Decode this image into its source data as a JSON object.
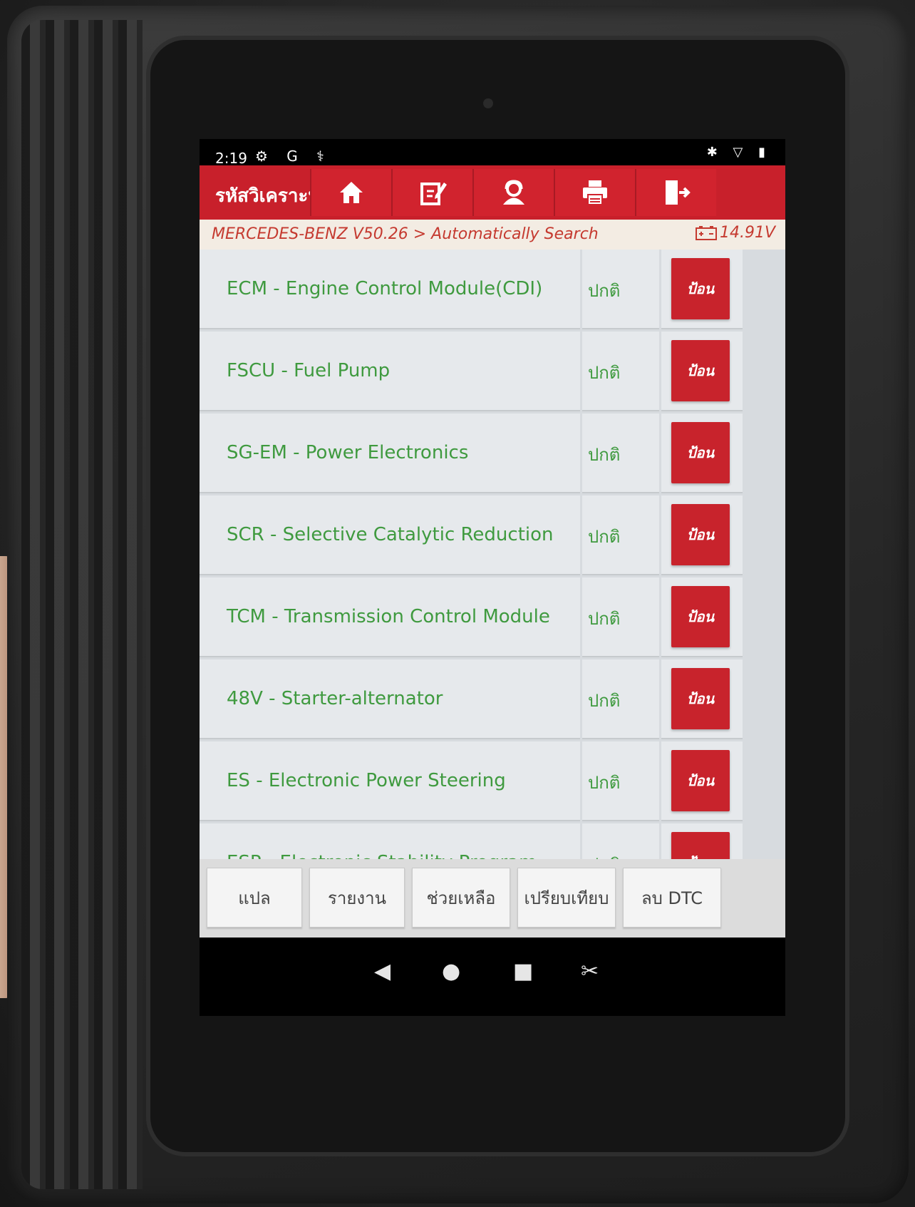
{
  "status_bar": {
    "time": "2:19",
    "left_icons": "⚙ G ⚕",
    "right_icons": "✱ ▽ ▮"
  },
  "header": {
    "title": "รหัสวิเคราะห์",
    "toolbar": [
      "home-icon",
      "edit-icon",
      "support-icon",
      "print-icon",
      "exit-icon"
    ]
  },
  "breadcrumb": {
    "path": "MERCEDES-BENZ V50.26 > Automatically Search",
    "voltage": "14.91V"
  },
  "modules": [
    {
      "name": "ECM - Engine Control Module(CDI)",
      "status": "ปกติ",
      "action": "ป้อน"
    },
    {
      "name": "FSCU - Fuel Pump",
      "status": "ปกติ",
      "action": "ป้อน"
    },
    {
      "name": "SG-EM - Power Electronics",
      "status": "ปกติ",
      "action": "ป้อน"
    },
    {
      "name": "SCR - Selective Catalytic Reduction",
      "status": "ปกติ",
      "action": "ป้อน"
    },
    {
      "name": "TCM - Transmission Control Module",
      "status": "ปกติ",
      "action": "ป้อน"
    },
    {
      "name": "48V - Starter-alternator",
      "status": "ปกติ",
      "action": "ป้อน"
    },
    {
      "name": "ES - Electronic Power Steering",
      "status": "ปกติ",
      "action": "ป้อน"
    },
    {
      "name": "ESP - Electronic Stability Program",
      "status": "ปกติ",
      "action": "ป้อน"
    }
  ],
  "bottom_buttons": [
    "แปล",
    "รายงาน",
    "ช่วยเหลือ",
    "เปรียบเทียบ",
    "ลบ DTC"
  ],
  "nav": {
    "back": "◀",
    "home": "●",
    "recents": "■",
    "extra": "✂"
  },
  "colors": {
    "header_red": "#c8202b",
    "text_green": "#3f9a3f",
    "button_red": "#c8232c"
  }
}
